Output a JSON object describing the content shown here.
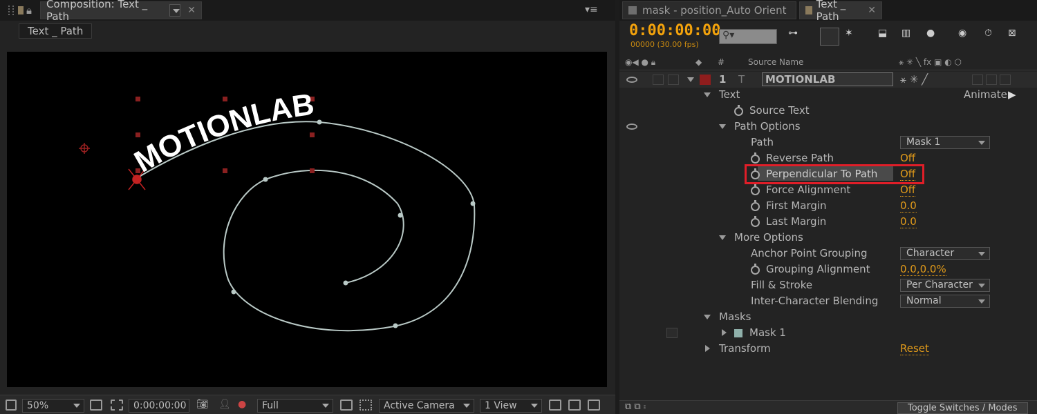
{
  "comp_panel": {
    "tab_label": "Composition: Text _ Path",
    "breadcrumb": "Text _ Path",
    "viewer_text": "MOTIONLAB",
    "zoom": "50%",
    "timecode": "0:00:00:00",
    "resolution": "Full",
    "camera": "Active Camera",
    "views": "1 View"
  },
  "timeline_panel": {
    "tab_inactive": "mask - position_Auto Orient",
    "tab_active": "Text _ Path",
    "timecode": "0:00:00:00",
    "fps": "00000 (30.00 fps)",
    "columns": {
      "num": "#",
      "source": "Source Name"
    },
    "layer": {
      "index": "1",
      "name": "MOTIONLAB",
      "color": "#8f1d1d"
    },
    "animate_label": "Animate:",
    "props": {
      "text": "Text",
      "source_text": "Source Text",
      "path_options": "Path Options",
      "path": "Path",
      "path_value": "Mask 1",
      "reverse_path": "Reverse Path",
      "reverse_path_value": "Off",
      "perpendicular": "Perpendicular To Path",
      "perpendicular_value": "Off",
      "force_alignment": "Force Alignment",
      "force_alignment_value": "Off",
      "first_margin": "First Margin",
      "first_margin_value": "0.0",
      "last_margin": "Last Margin",
      "last_margin_value": "0.0",
      "more_options": "More Options",
      "anchor_grouping": "Anchor Point Grouping",
      "anchor_grouping_value": "Character",
      "grouping_alignment": "Grouping Alignment",
      "grouping_alignment_value": "0.0,0.0%",
      "fill_stroke": "Fill & Stroke",
      "fill_stroke_value": "Per Character",
      "blending": "Inter-Character Blending",
      "blending_value": "Normal",
      "masks": "Masks",
      "mask1": "Mask 1",
      "transform": "Transform",
      "reset": "Reset"
    },
    "toggle_label": "Toggle Switches / Modes"
  },
  "colors": {
    "accent": "#f2a20c",
    "highlight": "#e01e28",
    "path": "#b9c9c6"
  }
}
